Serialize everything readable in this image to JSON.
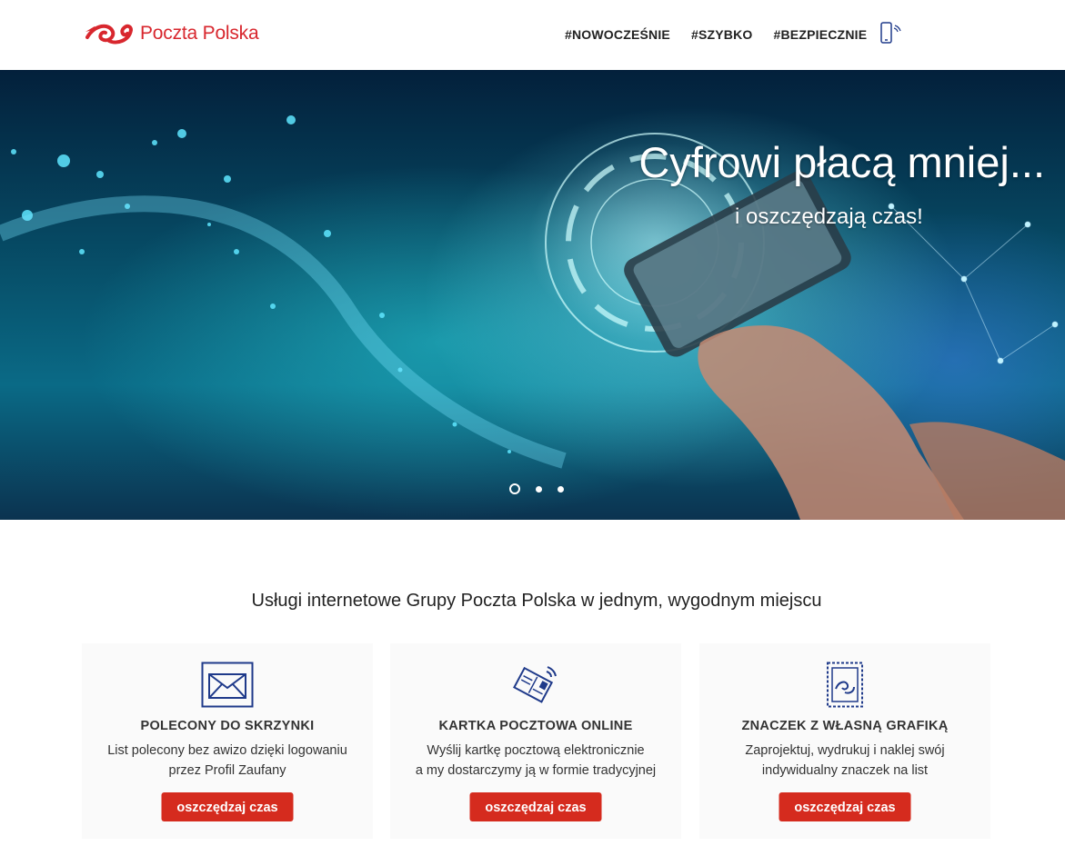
{
  "header": {
    "logo_text": "Poczta Polska",
    "nav": [
      "#NOWOCZEŚNIE",
      "#SZYBKO",
      "#BEZPIECZNIE"
    ],
    "nav_icon": "smartphone-icon"
  },
  "hero": {
    "title": "Cyfrowi płacą mniej...",
    "subtitle": "i oszczędzają czas!",
    "slides_count": 3,
    "active_slide": 1
  },
  "section": {
    "title": "Usługi internetowe Grupy Poczta Polska w jednym, wygodnym miejscu"
  },
  "cards": [
    {
      "icon": "envelope-icon",
      "title": "POLECONY DO SKRZYNKI",
      "desc1": "List polecony bez awizo dzięki logowaniu",
      "desc2": "przez Profil Zaufany",
      "button": "oszczędzaj czas"
    },
    {
      "icon": "postcard-icon",
      "title": "KARTKA POCZTOWA ONLINE",
      "desc1": "Wyślij kartkę pocztową elektronicznie",
      "desc2": "a my dostarczymy ją w formie tradycyjnej",
      "button": "oszczędzaj czas"
    },
    {
      "icon": "stamp-icon",
      "title": "ZNACZEK Z WŁASNĄ GRAFIKĄ",
      "desc1": "Zaprojektuj, wydrukuj i naklej swój",
      "desc2": "indywidualny znaczek na list",
      "button": "oszczędzaj czas"
    }
  ],
  "colors": {
    "brand_red": "#d8272e",
    "button_red": "#d52b1e",
    "icon_blue": "#1f3a8a"
  }
}
